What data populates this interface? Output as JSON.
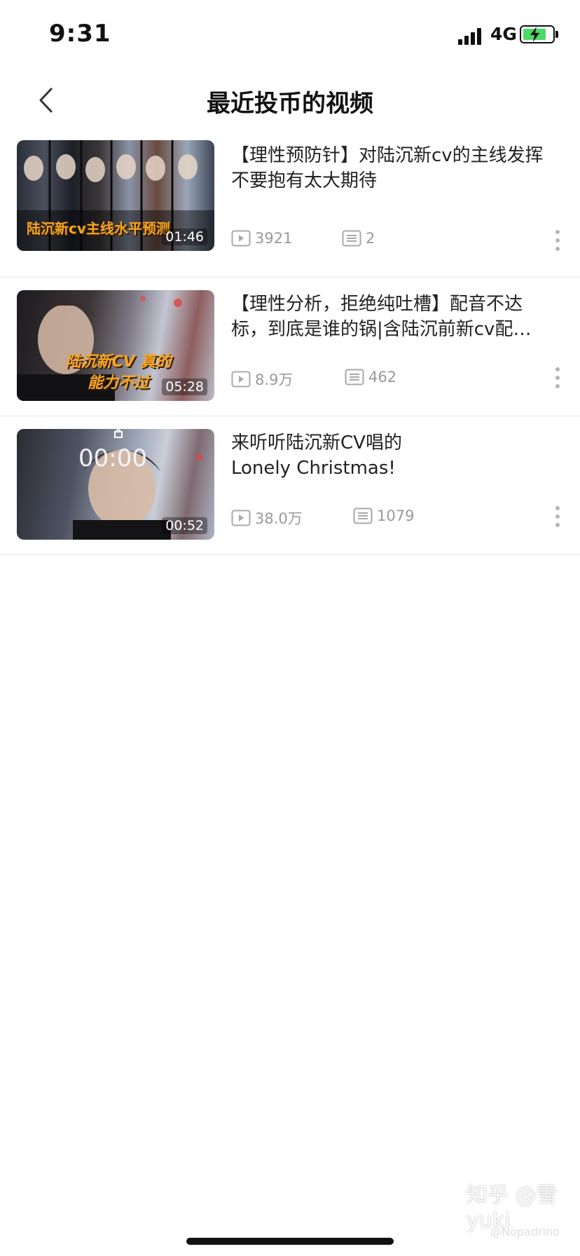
{
  "status_bar": {
    "time": "9:31",
    "network": "4G",
    "battery_charging": true
  },
  "nav": {
    "title": "最近投币的视频",
    "back_icon": "chevron-left-icon"
  },
  "videos": [
    {
      "thumbnail_caption": "陆沉新cv主线水平预测",
      "duration": "01:46",
      "title": "【理性预防针】对陆沉新cv的主线发挥不要抱有太大期待",
      "plays": "3921",
      "comments": "2"
    },
    {
      "thumbnail_caption": "陆沉新CV 真的能力不过",
      "duration": "05:28",
      "title": "【理性分析，拒绝纯吐槽】配音不达标，到底是谁的锅|含陆沉前新cv配…",
      "plays": "8.9万",
      "comments": "462"
    },
    {
      "thumbnail_caption": "00:00",
      "duration": "00:52",
      "title": "来听听陆沉新CV唱的\nLonely  Christmas!",
      "plays": "38.0万",
      "comments": "1079"
    }
  ],
  "watermark": {
    "text": "知乎 @雪yuki",
    "sub": "@Nopadrino"
  },
  "colors": {
    "accent_caption": "#f5a623",
    "muted_text": "#999999",
    "battery": "#4cd964"
  }
}
